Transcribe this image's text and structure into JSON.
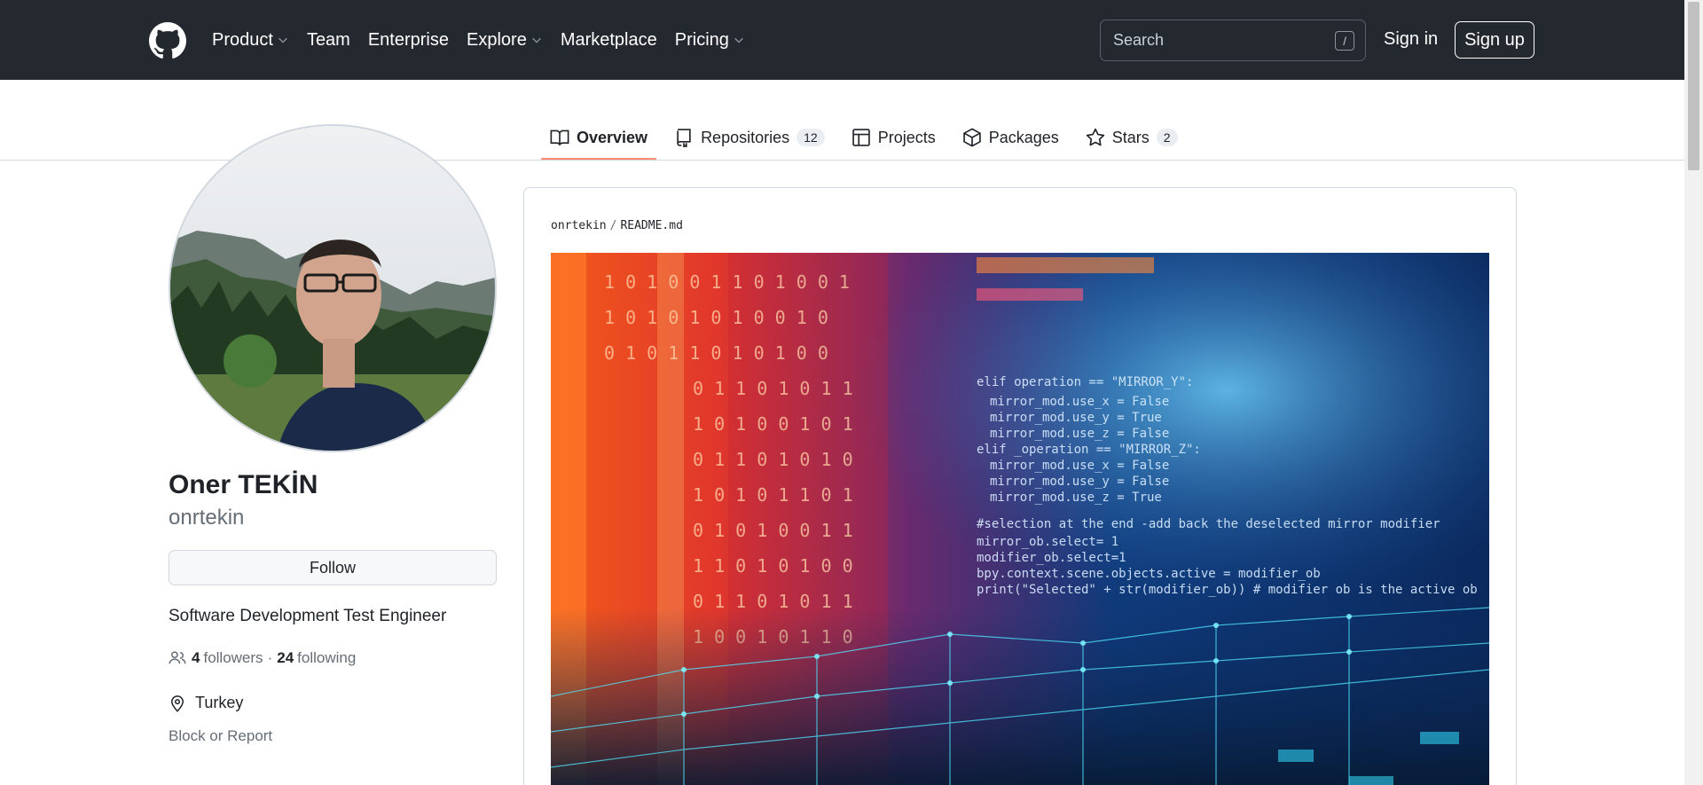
{
  "header": {
    "nav": [
      {
        "label": "Product",
        "dropdown": true
      },
      {
        "label": "Team",
        "dropdown": false
      },
      {
        "label": "Enterprise",
        "dropdown": false
      },
      {
        "label": "Explore",
        "dropdown": true
      },
      {
        "label": "Marketplace",
        "dropdown": false
      },
      {
        "label": "Pricing",
        "dropdown": true
      }
    ],
    "search_placeholder": "Search",
    "search_shortcut": "/",
    "sign_in": "Sign in",
    "sign_up": "Sign up"
  },
  "tabs": [
    {
      "label": "Overview",
      "icon": "book-icon",
      "active": true
    },
    {
      "label": "Repositories",
      "icon": "repo-icon",
      "count": "12"
    },
    {
      "label": "Projects",
      "icon": "table-icon"
    },
    {
      "label": "Packages",
      "icon": "package-icon"
    },
    {
      "label": "Stars",
      "icon": "star-icon",
      "count": "2"
    }
  ],
  "profile": {
    "full_name": "Oner TEKİN",
    "username": "onrtekin",
    "follow_label": "Follow",
    "bio": "Software Development Test Engineer",
    "followers_count": "4",
    "followers_label": "followers",
    "separator": "·",
    "following_count": "24",
    "following_label": "following",
    "location": "Turkey",
    "block_label": "Block or Report"
  },
  "readme": {
    "owner": "onrtekin",
    "separator": "/",
    "file": "README.md"
  },
  "colors": {
    "header_bg": "#24292f",
    "active_tab_underline": "#fd8c73",
    "muted_text": "#656d76"
  }
}
